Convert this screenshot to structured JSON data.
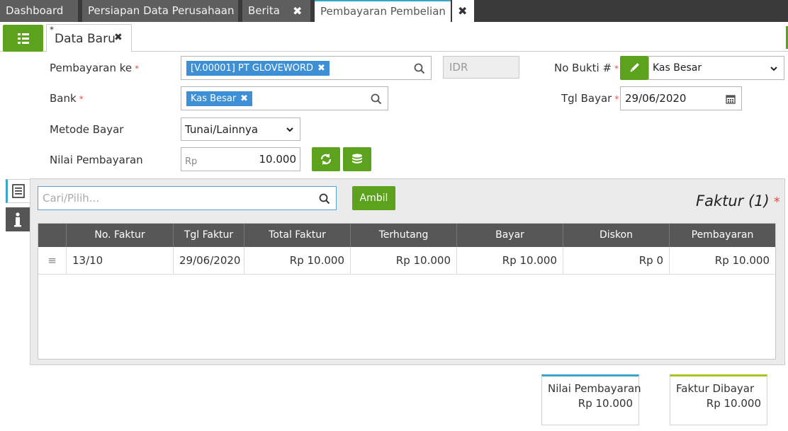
{
  "tabs": [
    {
      "label": "Dashboard"
    },
    {
      "label": "Persiapan Data Perusahaan"
    },
    {
      "label": "Berita"
    },
    {
      "label": "Pembayaran Pembelian"
    }
  ],
  "subtab": {
    "star": "*",
    "label": "Data Baru"
  },
  "form": {
    "pembayaran_ke": {
      "label": "Pembayaran ke",
      "value": "[V.00001] PT GLOVEWORD"
    },
    "currency": "IDR",
    "no_bukti": {
      "label": "No Bukti #",
      "value": "Kas Besar"
    },
    "bank": {
      "label": "Bank",
      "value": "Kas Besar"
    },
    "tgl_bayar": {
      "label": "Tgl Bayar",
      "value": "29/06/2020"
    },
    "metode_bayar": {
      "label": "Metode Bayar",
      "value": "Tunai/Lainnya"
    },
    "nilai_pembayaran": {
      "label": "Nilai Pembayaran",
      "prefix": "Rp",
      "value": "10.000"
    },
    "required_mark": "*"
  },
  "detail": {
    "search_placeholder": "Cari/Pilih...",
    "ambil_label": "Ambil",
    "section_title": "Faktur (1)",
    "required_mark": "*"
  },
  "table": {
    "columns": [
      "No. Faktur",
      "Tgl Faktur",
      "Total Faktur",
      "Terhutang",
      "Bayar",
      "Diskon",
      "Pembayaran"
    ],
    "rows": [
      [
        "13/10",
        "29/06/2020",
        "Rp 10.000",
        "Rp 10.000",
        "Rp 10.000",
        "Rp 0",
        "Rp 10.000"
      ]
    ]
  },
  "summary": [
    {
      "title": "Nilai Pembayaran",
      "value": "Rp 10.000",
      "accent": "#39a6c9"
    },
    {
      "title": "Faktur Dibayar",
      "value": "Rp 10.000",
      "accent": "#a7c520"
    }
  ],
  "colors": {
    "green": "#5da21d",
    "chip_blue": "#3d8fd6",
    "tab_active_accent": "#39a6c9"
  }
}
